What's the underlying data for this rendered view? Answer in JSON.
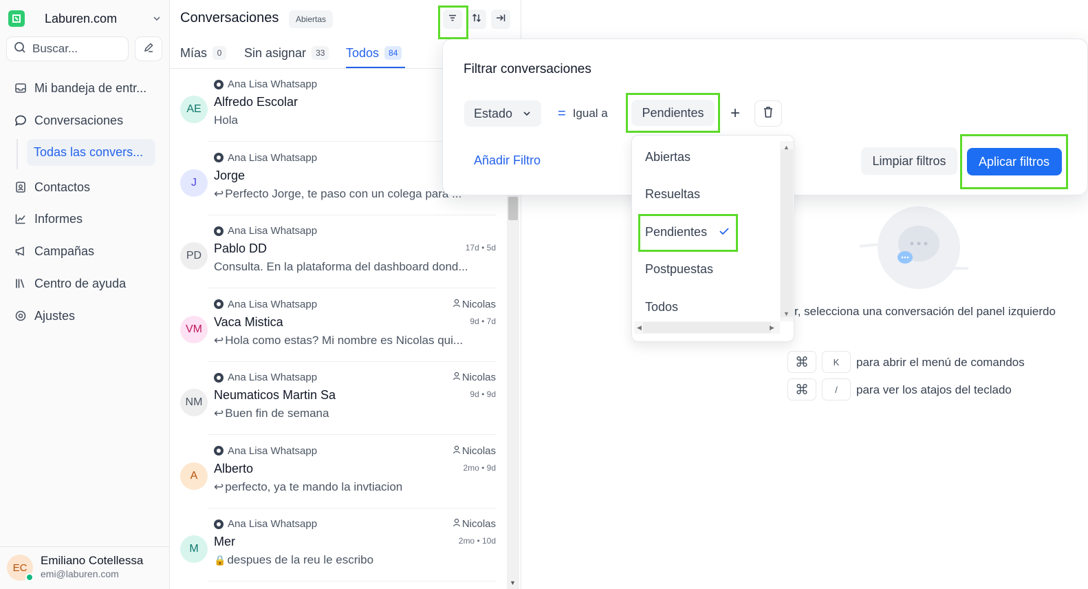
{
  "sidebar": {
    "brand": "Laburen.com",
    "search_label": "Buscar...",
    "nav": [
      {
        "label": "Mi bandeja de entr...",
        "icon": "inbox-icon"
      },
      {
        "label": "Conversaciones",
        "icon": "chat-bubble-icon"
      },
      {
        "label": "Contactos",
        "icon": "contact-card-icon"
      },
      {
        "label": "Informes",
        "icon": "chart-line-icon"
      },
      {
        "label": "Campañas",
        "icon": "megaphone-icon"
      },
      {
        "label": "Centro de ayuda",
        "icon": "library-icon"
      },
      {
        "label": "Ajustes",
        "icon": "settings-icon"
      }
    ],
    "sub_item": "Todas las convers...",
    "profile": {
      "initials": "EC",
      "name": "Emiliano Cotellessa",
      "email": "emi@laburen.com"
    }
  },
  "list": {
    "title": "Conversaciones",
    "status_badge": "Abiertas",
    "tabs": [
      {
        "label": "Mías",
        "count": "0"
      },
      {
        "label": "Sin asignar",
        "count": "33"
      },
      {
        "label": "Todos",
        "count": "84"
      }
    ],
    "conversations": [
      {
        "initials": "AE",
        "source": "Ana Lisa Whatsapp",
        "agent": "",
        "name": "Alfredo Escolar",
        "time": "",
        "message": "Hola",
        "prefix": "",
        "av_bg": "#d7f5ec",
        "av_fg": "#0f766e"
      },
      {
        "initials": "J",
        "source": "Ana Lisa Whatsapp",
        "agent": "",
        "name": "Jorge",
        "time": "",
        "message": "Perfecto Jorge, te paso con un colega para ...",
        "prefix": "↩",
        "av_bg": "#e3e8ff",
        "av_fg": "#4f46e5"
      },
      {
        "initials": "PD",
        "source": "Ana Lisa Whatsapp",
        "agent": "",
        "name": "Pablo DD",
        "time": "17d • 5d",
        "message": "Consulta. En la plataforma del dashboard dond...",
        "prefix": "",
        "av_bg": "#eeeeee",
        "av_fg": "#4b5563"
      },
      {
        "initials": "VM",
        "source": "Ana Lisa Whatsapp",
        "agent": "Nicolas",
        "name": "Vaca Mistica",
        "time": "9d • 7d",
        "message": "Hola como estas? Mi nombre es Nicolas qui...",
        "prefix": "↩",
        "av_bg": "#fde2f3",
        "av_fg": "#be185d"
      },
      {
        "initials": "NM",
        "source": "Ana Lisa Whatsapp",
        "agent": "Nicolas",
        "name": "Neumaticos Martin Sa",
        "time": "9d • 9d",
        "message": "Buen fin de semana",
        "prefix": "↩",
        "av_bg": "#eeeeee",
        "av_fg": "#4b5563"
      },
      {
        "initials": "A",
        "source": "Ana Lisa Whatsapp",
        "agent": "Nicolas",
        "name": "Alberto",
        "time": "2mo • 9d",
        "message": "perfecto, ya te mando la invtiacion",
        "prefix": "↩",
        "av_bg": "#fde7cf",
        "av_fg": "#b45309"
      },
      {
        "initials": "M",
        "source": "Ana Lisa Whatsapp",
        "agent": "Nicolas",
        "name": "Mer",
        "time": "2mo • 10d",
        "message": "despues de la reu le escribo",
        "prefix": "🔒",
        "av_bg": "#d7f5ec",
        "av_fg": "#0f766e"
      }
    ]
  },
  "filter": {
    "title": "Filtrar conversaciones",
    "field": "Estado",
    "operator": "Igual a",
    "value": "Pendientes",
    "add_filter": "Añadir Filtro",
    "clear": "Limpiar filtros",
    "apply": "Aplicar filtros",
    "options": [
      "Abiertas",
      "Resueltas",
      "Pendientes",
      "Postpuestas",
      "Todos"
    ],
    "selected_option": "Pendientes"
  },
  "main": {
    "empty_text": "r, selecciona una conversación del panel izquierdo",
    "shortcuts": [
      {
        "key1": "⌘",
        "key2": "K",
        "text": "para abrir el menú de comandos"
      },
      {
        "key1": "⌘",
        "key2": "/",
        "text": "para ver los atajos del teclado"
      }
    ]
  },
  "colors": {
    "accent": "#2563eb",
    "highlight": "#5cdb2a",
    "brand": "#2ecc71"
  }
}
